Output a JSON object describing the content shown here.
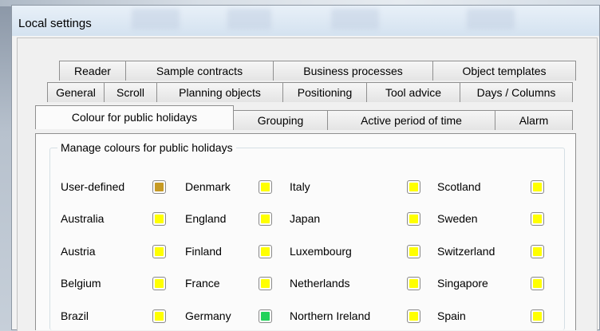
{
  "window": {
    "title": "Local settings"
  },
  "tabs": {
    "row1": [
      "Reader",
      "Sample contracts",
      "Business processes",
      "Object templates"
    ],
    "row2": [
      "General",
      "Scroll",
      "Planning objects",
      "Positioning",
      "Tool advice",
      "Days / Columns"
    ],
    "row3": [
      "Colour for public holidays",
      "Grouping",
      "Active period of time",
      "Alarm"
    ],
    "active": "Colour for public holidays"
  },
  "group": {
    "title": "Manage colours for public holidays"
  },
  "colors": {
    "yellow": "#ffff00",
    "user_defined": "#c69a24",
    "green": "#22d25a",
    "swatch_border": "#8a8a8a"
  },
  "holidays": {
    "columns": [
      [
        {
          "name": "User-defined",
          "color": "#c69a24"
        },
        {
          "name": "Australia",
          "color": "#ffff00"
        },
        {
          "name": "Austria",
          "color": "#ffff00"
        },
        {
          "name": "Belgium",
          "color": "#ffff00"
        },
        {
          "name": "Brazil",
          "color": "#ffff00"
        }
      ],
      [
        {
          "name": "Denmark",
          "color": "#ffff00"
        },
        {
          "name": "England",
          "color": "#ffff00"
        },
        {
          "name": "Finland",
          "color": "#ffff00"
        },
        {
          "name": "France",
          "color": "#ffff00"
        },
        {
          "name": "Germany",
          "color": "#22d25a"
        }
      ],
      [
        {
          "name": "Italy",
          "color": "#ffff00"
        },
        {
          "name": "Japan",
          "color": "#ffff00"
        },
        {
          "name": "Luxembourg",
          "color": "#ffff00"
        },
        {
          "name": "Netherlands",
          "color": "#ffff00"
        },
        {
          "name": "Northern Ireland",
          "color": "#ffff00"
        }
      ],
      [
        {
          "name": "Scotland",
          "color": "#ffff00"
        },
        {
          "name": "Sweden",
          "color": "#ffff00"
        },
        {
          "name": "Switzerland",
          "color": "#ffff00"
        },
        {
          "name": "Singapore",
          "color": "#ffff00"
        },
        {
          "name": "Spain",
          "color": "#ffff00"
        }
      ]
    ]
  }
}
